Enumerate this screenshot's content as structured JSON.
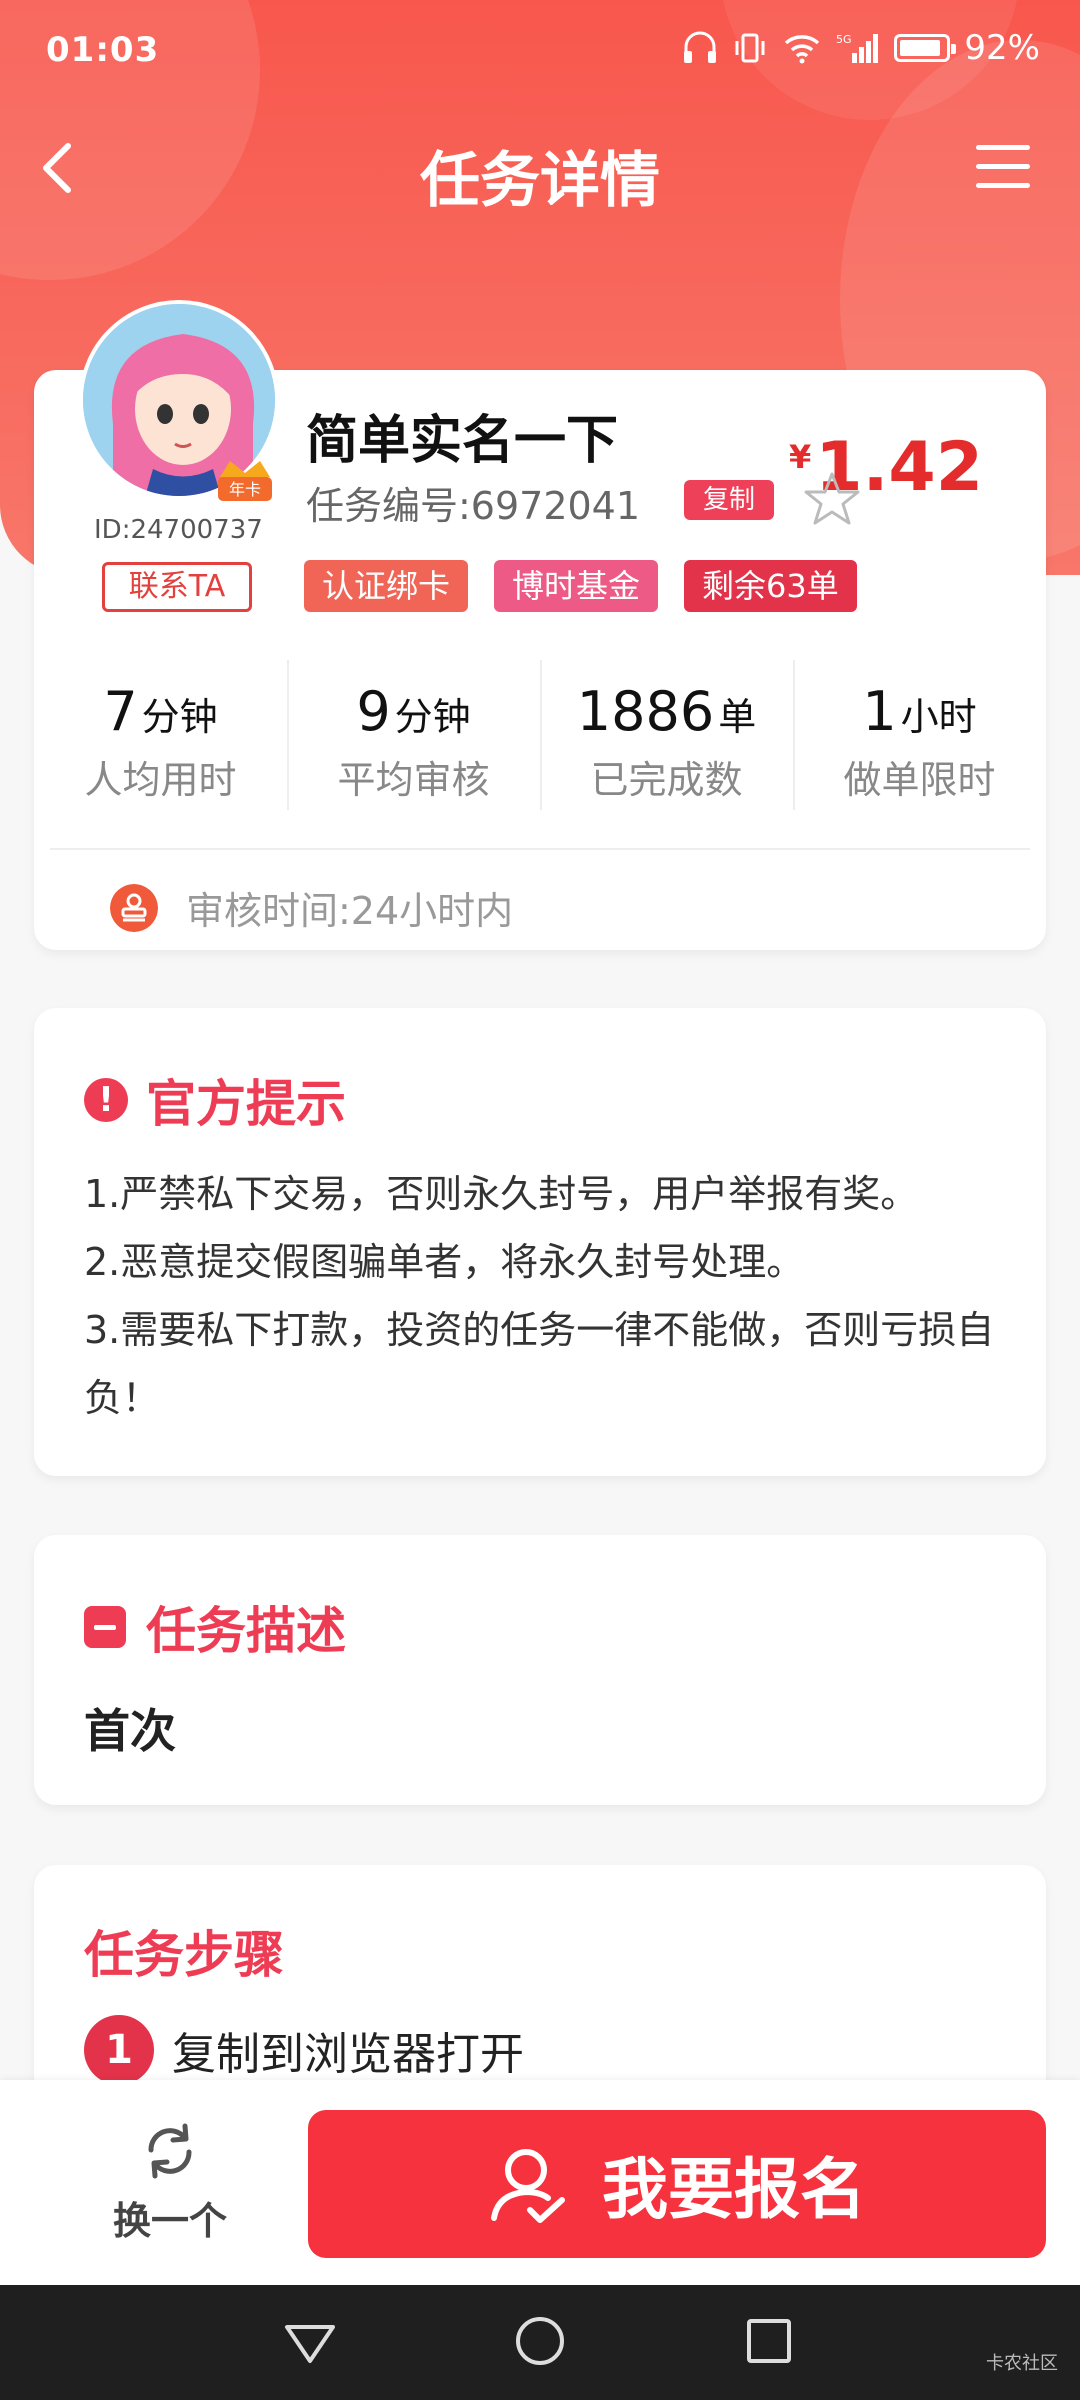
{
  "status_bar": {
    "time": "01:03",
    "battery": "92%",
    "battery_level": 0.92,
    "network": "5G"
  },
  "header": {
    "title": "任务详情"
  },
  "task": {
    "name": "简单实名一下",
    "task_no_label": "任务编号:6972041",
    "copy_label": "复制",
    "currency": "¥",
    "price": "1.42",
    "user_id": "ID:24700737",
    "avatar_badge": "年卡",
    "contact_label": "联系TA",
    "tags": [
      "认证绑卡",
      "博时基金",
      "剩余63单"
    ]
  },
  "stats": [
    {
      "value": "7",
      "unit": "分钟",
      "label": "人均用时"
    },
    {
      "value": "9",
      "unit": "分钟",
      "label": "平均审核"
    },
    {
      "value": "1886",
      "unit": "单",
      "label": "已完成数"
    },
    {
      "value": "1",
      "unit": "小时",
      "label": "做单限时"
    }
  ],
  "review_time": "审核时间:24小时内",
  "notice": {
    "title": "官方提示",
    "items": [
      "1.严禁私下交易，否则永久封号，用户举报有奖。",
      "2.恶意提交假图骗单者，将永久封号处理。",
      "3.需要私下打款，投资的任务一律不能做，否则亏损自负！"
    ]
  },
  "description": {
    "title": "任务描述",
    "text": "首次"
  },
  "steps": {
    "title": "任务步骤",
    "items": [
      {
        "num": "1",
        "text": "复制到浏览器打开"
      }
    ]
  },
  "bottom": {
    "switch_label": "换一个",
    "signup_label": "我要报名"
  },
  "watermark": "卡农社区",
  "colors": {
    "primary": "#f5323d",
    "header": "#f8574d",
    "accent_pink": "#ef3c55"
  }
}
